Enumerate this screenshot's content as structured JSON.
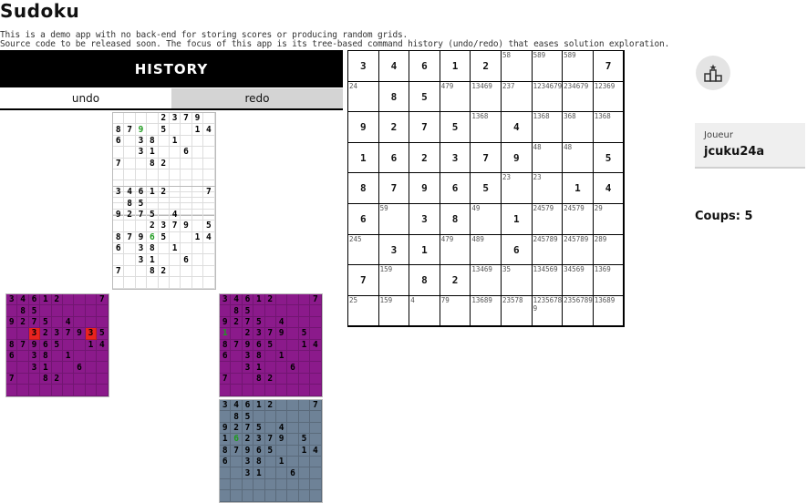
{
  "app": {
    "title": "Sudoku",
    "desc_line1": "This is a demo app with no back-end for storing scores or producing random grids.",
    "desc_line2": "Source code to be released soon. The focus of this app is its tree-based command history (undo/redo) that eases solution exploration."
  },
  "history": {
    "title": "HISTORY",
    "undo_label": "undo",
    "redo_label": "redo",
    "snapshots": [
      {
        "style": "white",
        "rows": [
          "    2379 5",
          "879 5  14",
          "6 38 1",
          "  31  6",
          "7  82",
          "",
          "",
          "",
          ""
        ],
        "green": [
          [
            1,
            2
          ]
        ],
        "red": []
      },
      {
        "style": "white",
        "rows": [
          "34612   7",
          " 85",
          "9275 4",
          "   2379 5",
          "87965  14",
          "6 38 1",
          "  31  6",
          "7  82",
          ""
        ],
        "green": [
          [
            4,
            3
          ]
        ],
        "red": []
      },
      {
        "style": "purple",
        "rows": [
          "34612   7",
          " 85",
          "9275 4",
          "   2379 5",
          "87965  14",
          "6 38 1",
          "  31  6",
          "7  82",
          ""
        ],
        "green": [],
        "red": [
          [
            3,
            2
          ],
          [
            3,
            7
          ]
        ],
        "red_text": "3"
      },
      {
        "style": "purple",
        "rows": [
          "34612   7",
          " 85",
          "9275 4",
          "1 2379 5",
          "87965  14",
          "6 38 1",
          "  31  6",
          "7  82",
          ""
        ],
        "green": [
          [
            3,
            0
          ]
        ],
        "red": []
      },
      {
        "style": "gray",
        "rows": [
          "34612   7",
          " 85",
          "9275 4",
          "162379 5",
          "87965  14",
          "6 38 1",
          "  31  6",
          "",
          ""
        ],
        "green": [
          [
            3,
            1
          ]
        ],
        "red": []
      }
    ]
  },
  "board": {
    "cells": [
      [
        "3",
        "4",
        "6",
        "1",
        "2",
        "58|",
        "589|",
        "589|",
        "7"
      ],
      [
        "24|",
        "8",
        "5",
        "479|",
        "13469|",
        "237|",
        "1234679|",
        "234679|",
        "12369|"
      ],
      [
        "9",
        "2",
        "7",
        "5",
        "1368|",
        "4",
        "1368|",
        "368|",
        "1368|"
      ],
      [
        "1",
        "6",
        "2",
        "3",
        "7",
        "9",
        "48|",
        "48|",
        "5"
      ],
      [
        "8",
        "7",
        "9",
        "6",
        "5",
        "23|",
        "23|",
        "1",
        "4"
      ],
      [
        "6",
        "59|",
        "3",
        "8",
        "49|",
        "1",
        "24579|",
        "24579|",
        "29|"
      ],
      [
        "245|",
        "3",
        "1",
        "479|",
        "489|",
        "6",
        "245789|",
        "245789|",
        "289|"
      ],
      [
        "7",
        "159|",
        "8",
        "2",
        "13469|",
        "35|",
        "134569|",
        "34569|",
        "1369|"
      ],
      [
        "25|",
        "159|",
        "4|",
        "79|",
        "13689|",
        "23578|",
        "12356789|",
        "2356789|",
        "13689|"
      ]
    ]
  },
  "sidebar": {
    "trophy_icon": "podium-icon",
    "player_label": "Joueur",
    "player_name": "jcuku24a",
    "moves_text": "Coups: 5"
  }
}
